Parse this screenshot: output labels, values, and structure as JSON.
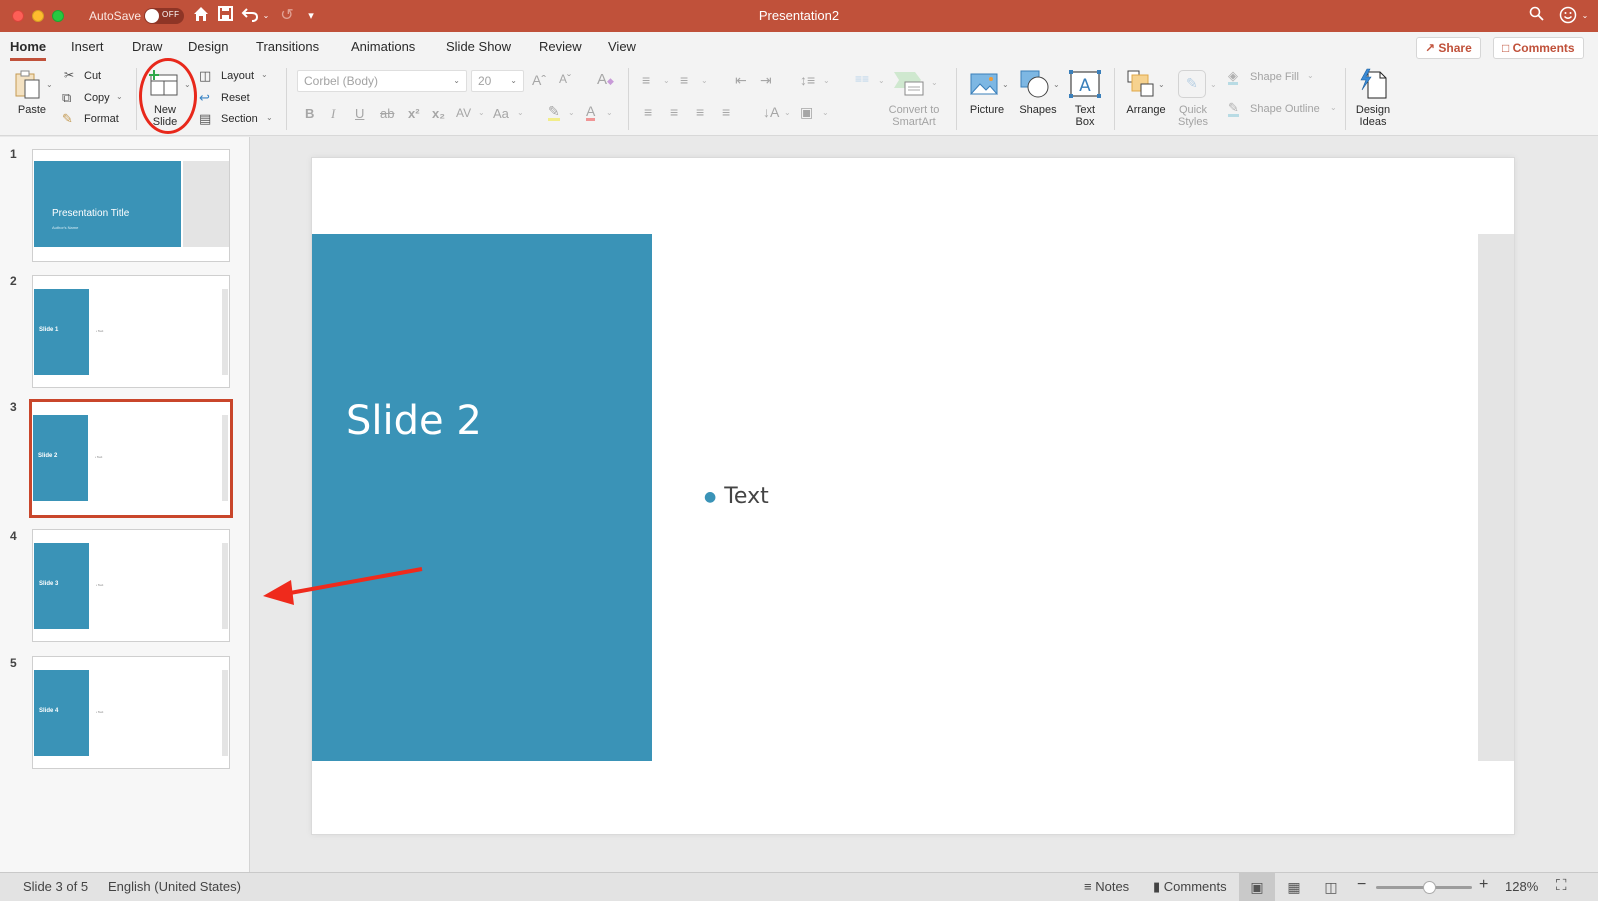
{
  "titlebar": {
    "autosave_label": "AutoSave",
    "autosave_state": "OFF",
    "window_title": "Presentation2",
    "icons": [
      "home-icon",
      "save-icon",
      "undo-icon",
      "redo-icon",
      "customize-toolbar-icon",
      "search-icon",
      "feedback-smiley-icon"
    ]
  },
  "tabs": [
    {
      "label": "Home",
      "active": true
    },
    {
      "label": "Insert"
    },
    {
      "label": "Draw"
    },
    {
      "label": "Design"
    },
    {
      "label": "Transitions"
    },
    {
      "label": "Animations"
    },
    {
      "label": "Slide Show"
    },
    {
      "label": "Review"
    },
    {
      "label": "View"
    }
  ],
  "share_button": "Share",
  "comments_button": "Comments",
  "ribbon": {
    "paste": "Paste",
    "cut": "Cut",
    "copy": "Copy",
    "format": "Format",
    "new_slide_line1": "New",
    "new_slide_line2": "Slide",
    "layout": "Layout",
    "reset": "Reset",
    "section": "Section",
    "font_name": "Corbel (Body)",
    "font_size": "20",
    "grow_font": "Aˆ",
    "shrink_font": "Aˇ",
    "bold": "B",
    "italic": "I",
    "underline": "U",
    "strikethrough": "ab",
    "superscript": "x²",
    "subscript": "x₂",
    "char_spacing": "AV",
    "change_case": "Aa",
    "convert_smartart_line1": "Convert to",
    "convert_smartart_line2": "SmartArt",
    "picture": "Picture",
    "shapes": "Shapes",
    "textbox_line1": "Text",
    "textbox_line2": "Box",
    "arrange": "Arrange",
    "quick_styles_line1": "Quick",
    "quick_styles_line2": "Styles",
    "shape_fill": "Shape Fill",
    "shape_outline": "Shape Outline",
    "design_ideas_line1": "Design",
    "design_ideas_line2": "Ideas"
  },
  "slides": [
    {
      "number": "1",
      "title": "Presentation Title",
      "subtitle": "Author's Name",
      "layout": "title"
    },
    {
      "number": "2",
      "title": "Slide 1",
      "bullet": "Text",
      "layout": "content"
    },
    {
      "number": "3",
      "title": "Slide 2",
      "bullet": "Text",
      "layout": "content",
      "selected": true
    },
    {
      "number": "4",
      "title": "Slide 3",
      "bullet": "Text",
      "layout": "content"
    },
    {
      "number": "5",
      "title": "Slide 4",
      "bullet": "Text",
      "layout": "content"
    }
  ],
  "editor": {
    "slide_title": "Slide 2",
    "bullet_text": "Text"
  },
  "status": {
    "slide_position": "Slide 3 of 5",
    "language": "English (United States)",
    "notes": "Notes",
    "comments": "Comments",
    "zoom_level": "128%",
    "zoom_slider_fraction": 0.55
  },
  "colors": {
    "accent": "#c0513a",
    "slide_blue": "#3a93b7",
    "annotation_red": "#e8281b"
  }
}
